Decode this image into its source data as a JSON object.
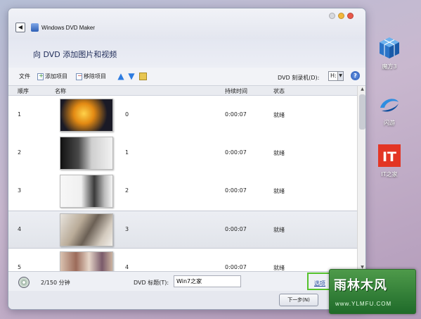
{
  "window": {
    "title": "Windows DVD Maker",
    "back": "◀",
    "heading": "向 DVD 添加图片和视频"
  },
  "toolbar": {
    "file": "文件",
    "add": "添加项目",
    "remove": "移除项目",
    "burner_label": "DVD 刻录机(D):",
    "burner_value": "H:",
    "help": "?"
  },
  "table": {
    "columns": [
      "顺序",
      "名称",
      "持续时间",
      "状态"
    ],
    "rows": [
      {
        "order": "1",
        "name": "0",
        "duration": "0:00:07",
        "status": "就绪"
      },
      {
        "order": "2",
        "name": "1",
        "duration": "0:00:07",
        "status": "就绪"
      },
      {
        "order": "3",
        "name": "2",
        "duration": "0:00:07",
        "status": "就绪"
      },
      {
        "order": "4",
        "name": "3",
        "duration": "0:00:07",
        "status": "就绪"
      },
      {
        "order": "5",
        "name": "4",
        "duration": "0:00:07",
        "status": "就绪"
      }
    ]
  },
  "status": {
    "duration": "2/150 分钟",
    "title_label": "DVD 标题(T):",
    "title_value": "Win7之家",
    "options": "选项"
  },
  "footer": {
    "next": "下一步(N)"
  },
  "desktop": {
    "icons": [
      "魔方3",
      "闪游",
      "IT之家"
    ]
  },
  "watermark": {
    "main": "雨林木风",
    "url": "www.YLMFU.COM"
  },
  "colors": {
    "accent": "#2d7be0",
    "highlight": "#55c22c",
    "it_red": "#e33524",
    "watermark_green": "#2f7d33"
  }
}
